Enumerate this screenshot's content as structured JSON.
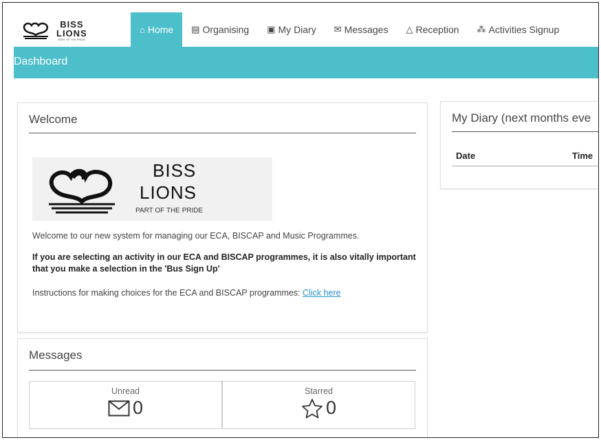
{
  "brand": {
    "name_line1": "BISS",
    "name_line2": "LIONS",
    "tagline": "PART OF THE PRIDE"
  },
  "nav": {
    "items": [
      {
        "label": "Home",
        "icon": "home-icon",
        "active": true
      },
      {
        "label": "Organising",
        "icon": "clipboard-icon",
        "active": false
      },
      {
        "label": "My Diary",
        "icon": "notebook-icon",
        "active": false
      },
      {
        "label": "Messages",
        "icon": "envelope-open-icon",
        "active": false
      },
      {
        "label": "Reception",
        "icon": "triangle-icon",
        "active": false
      },
      {
        "label": "Activities Signup",
        "icon": "network-icon",
        "active": false
      }
    ]
  },
  "subheader": {
    "title": "Dashboard"
  },
  "welcome": {
    "title": "Welcome",
    "intro": "Welcome to our new system for managing our ECA, BISCAP and Music Programmes.",
    "notice": "If you are selecting an activity in our ECA and BISCAP programmes, it is also vitally important that you make a selection in the 'Bus Sign Up'",
    "instructions": "Instructions for making choices for the ECA and BISCAP programmes:",
    "link": "Click here"
  },
  "messages": {
    "title": "Messages",
    "unread_label": "Unread",
    "unread_count": "0",
    "starred_label": "Starred",
    "starred_count": "0"
  },
  "diary": {
    "title": "My Diary (next months eve",
    "columns": [
      "Date",
      "Time"
    ]
  },
  "colors": {
    "accent": "#4cbfcb"
  }
}
